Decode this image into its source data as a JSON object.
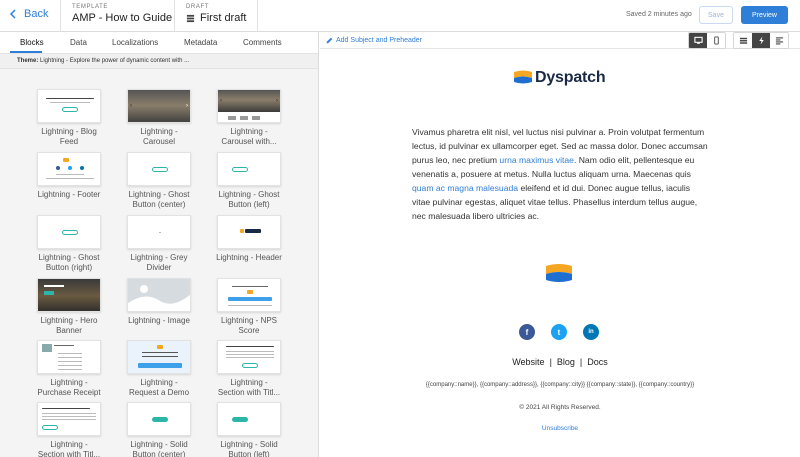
{
  "header": {
    "back_label": "Back",
    "template_caption": "TEMPLATE",
    "template_name": "AMP - How to Guide",
    "draft_caption": "DRAFT",
    "draft_name": "First draft",
    "saved_status": "Saved 2 minutes ago",
    "save_label": "Save",
    "preview_label": "Preview"
  },
  "left_panel": {
    "tabs": [
      {
        "label": "Blocks",
        "active": true
      },
      {
        "label": "Data",
        "active": false
      },
      {
        "label": "Localizations",
        "active": false
      },
      {
        "label": "Metadata",
        "active": false
      },
      {
        "label": "Comments",
        "active": false
      }
    ],
    "theme_label": "Theme:",
    "theme_text": "Lightning - Explore the power of dynamic content with ...",
    "blocks": [
      {
        "label": "Lightning - Blog Feed"
      },
      {
        "label": "Lightning - Carousel"
      },
      {
        "label": "Lightning - Carousel with..."
      },
      {
        "label": "Lightning - Footer"
      },
      {
        "label": "Lightning - Ghost Button (center)"
      },
      {
        "label": "Lightning - Ghost Button (left)"
      },
      {
        "label": "Lightning - Ghost Button (right)"
      },
      {
        "label": "Lightning - Grey Divider"
      },
      {
        "label": "Lightning - Header"
      },
      {
        "label": "Lightning - Hero Banner"
      },
      {
        "label": "Lightning - Image"
      },
      {
        "label": "Lightning - NPS Score"
      },
      {
        "label": "Lightning - Purchase Receipt"
      },
      {
        "label": "Lightning - Request a Demo"
      },
      {
        "label": "Lightning - Section with Titl..."
      },
      {
        "label": "Lightning - Section with Titl..."
      },
      {
        "label": "Lightning - Solid Button (center)"
      },
      {
        "label": "Lightning - Solid Button (left)"
      }
    ]
  },
  "right_panel": {
    "add_subject_label": "Add Subject and Preheader",
    "logo_text": "Dyspatch",
    "body_part1": "Vivamus pharetra elit nisl, vel luctus nisi pulvinar a. Proin volutpat fermentum lectus, id pulvinar ex ullamcorper eget. Sed ac massa dolor. Donec accumsan purus leo, nec pretium ",
    "body_link1": "urna maximus vitae",
    "body_part2": ". Nam odio elit, pellentesque eu venenatis a, posuere at metus. Nulla luctus aliquam urna. Maecenas quis ",
    "body_link2": "quam ac magna malesuada",
    "body_part3": " eleifend et id dui. Donec augue tellus, iaculis vitae pulvinar egestas, aliquet vitae tellus. Phasellus interdum tellus augue, nec malesuada libero ultricies ac.",
    "social_facebook": "f",
    "social_twitter": "t",
    "social_linkedin": "in",
    "footer_link_website": "Website",
    "footer_link_blog": "Blog",
    "footer_link_docs": "Docs",
    "footer_sep": "|",
    "merge_fields": "{{company::name}}, {{company::address}}, {{company::city}} {{company::state}}, {{company::country}}",
    "copyright": "© 2021 All Rights Reserved.",
    "unsubscribe": "Unsubscribe"
  },
  "colors": {
    "accent": "#2f7ed8",
    "logo_orange": "#f5a623",
    "logo_blue": "#1f6fd1",
    "facebook": "#3b5998",
    "twitter": "#1da1f2",
    "linkedin": "#0077b5"
  },
  "icons": {
    "back": "chevron-left-icon",
    "template": "monitor-icon",
    "draft": "stack-icon",
    "edit": "pencil-icon",
    "desktop": "desktop-icon",
    "mobile": "mobile-icon",
    "layout": "list-icon",
    "bolt": "bolt-icon",
    "text": "text-icon"
  }
}
